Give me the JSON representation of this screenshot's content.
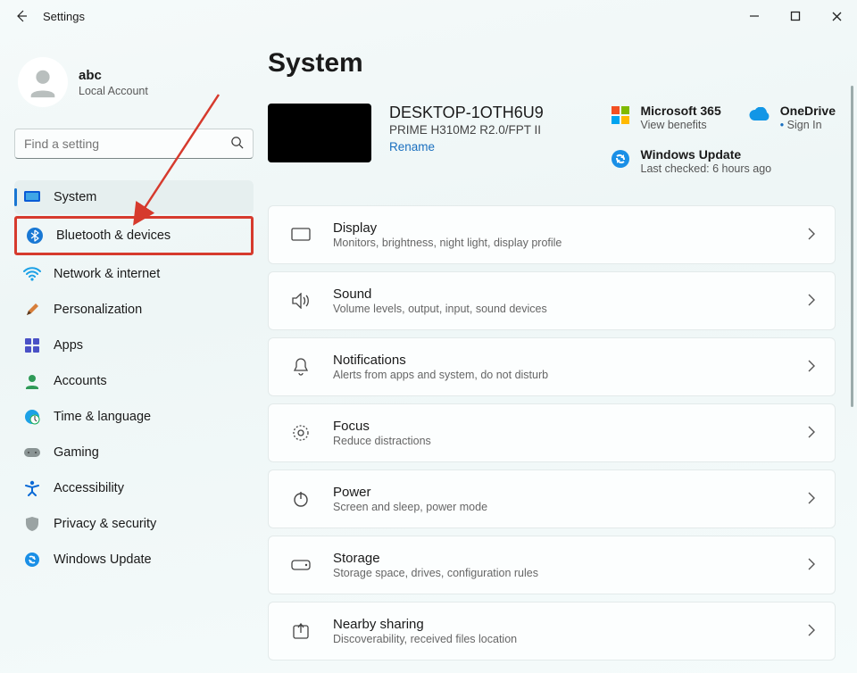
{
  "titlebar": {
    "title": "Settings"
  },
  "profile": {
    "name": "abc",
    "sub": "Local Account"
  },
  "search": {
    "placeholder": "Find a setting"
  },
  "nav": {
    "items": [
      {
        "label": "System"
      },
      {
        "label": "Bluetooth & devices"
      },
      {
        "label": "Network & internet"
      },
      {
        "label": "Personalization"
      },
      {
        "label": "Apps"
      },
      {
        "label": "Accounts"
      },
      {
        "label": "Time & language"
      },
      {
        "label": "Gaming"
      },
      {
        "label": "Accessibility"
      },
      {
        "label": "Privacy & security"
      },
      {
        "label": "Windows Update"
      }
    ]
  },
  "page": {
    "heading": "System",
    "device": {
      "name": "DESKTOP-1OTH6U9",
      "model": "PRIME H310M2 R2.0/FPT II",
      "rename": "Rename"
    },
    "m365": {
      "title": "Microsoft 365",
      "sub": "View benefits"
    },
    "onedrive": {
      "title": "OneDrive",
      "sub": "Sign In"
    },
    "wu": {
      "title": "Windows Update",
      "sub": "Last checked: 6 hours ago"
    },
    "items": [
      {
        "title": "Display",
        "sub": "Monitors, brightness, night light, display profile"
      },
      {
        "title": "Sound",
        "sub": "Volume levels, output, input, sound devices"
      },
      {
        "title": "Notifications",
        "sub": "Alerts from apps and system, do not disturb"
      },
      {
        "title": "Focus",
        "sub": "Reduce distractions"
      },
      {
        "title": "Power",
        "sub": "Screen and sleep, power mode"
      },
      {
        "title": "Storage",
        "sub": "Storage space, drives, configuration rules"
      },
      {
        "title": "Nearby sharing",
        "sub": "Discoverability, received files location"
      }
    ]
  }
}
